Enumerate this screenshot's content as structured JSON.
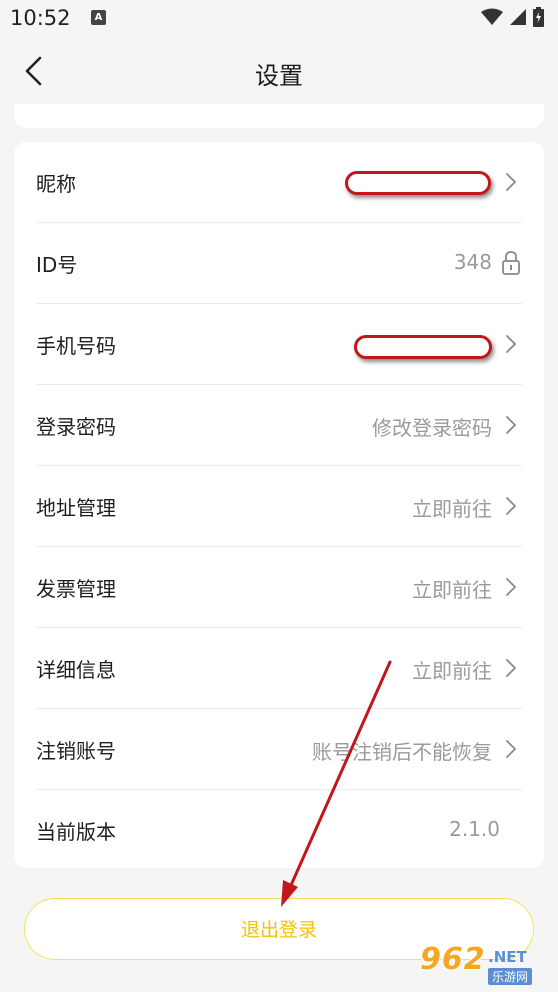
{
  "status_bar": {
    "time": "10:52",
    "notif_badge": "A"
  },
  "header": {
    "title": "设置"
  },
  "settings": [
    {
      "label": "昵称",
      "value": "",
      "type": "redacted"
    },
    {
      "label": "ID号",
      "value": "348",
      "type": "locked"
    },
    {
      "label": "手机号码",
      "value": "",
      "type": "redacted"
    },
    {
      "label": "登录密码",
      "value": "修改登录密码",
      "type": "link"
    },
    {
      "label": "地址管理",
      "value": "立即前往",
      "type": "link"
    },
    {
      "label": "发票管理",
      "value": "立即前往",
      "type": "link"
    },
    {
      "label": "详细信息",
      "value": "立即前往",
      "type": "link"
    },
    {
      "label": "注销账号",
      "value": "账号注销后不能恢复",
      "type": "link"
    },
    {
      "label": "当前版本",
      "value": "2.1.0",
      "type": "static"
    }
  ],
  "logout": {
    "label": "退出登录"
  },
  "colors": {
    "accent": "#f5c400",
    "annotation": "#c2161b"
  },
  "watermark": {
    "num": "962",
    "net": ".NET",
    "sub": "乐游网"
  }
}
